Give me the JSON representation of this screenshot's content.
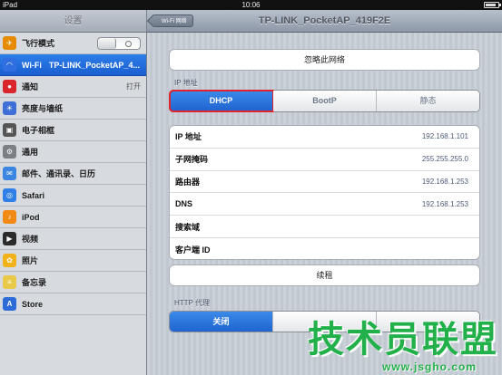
{
  "status_bar": {
    "carrier": "iPad",
    "time": "10:06",
    "battery_level": 0.85
  },
  "sidebar": {
    "title": "设置",
    "items": [
      {
        "label": "飞行模式",
        "icon": "airplane-icon",
        "color": "#e68a00",
        "toggle": true
      },
      {
        "label": "Wi-Fi",
        "network": "TP-LINK_PocketAP_4...",
        "icon": "wifi-icon",
        "color": "#2f6fe0",
        "selected": true
      },
      {
        "label": "通知",
        "value": "打开",
        "icon": "notification-icon",
        "color": "#d9262c"
      },
      {
        "label": "亮度与墙纸",
        "icon": "brightness-icon",
        "color": "#3d6fd6"
      },
      {
        "label": "电子相框",
        "icon": "picture-frame-icon",
        "color": "#555555"
      },
      {
        "label": "通用",
        "icon": "gear-icon",
        "color": "#7b7f86"
      },
      {
        "label": "邮件、通讯录、日历",
        "icon": "mail-icon",
        "color": "#3a86e0"
      },
      {
        "label": "Safari",
        "icon": "safari-icon",
        "color": "#2f7fe8"
      },
      {
        "label": "iPod",
        "icon": "ipod-icon",
        "color": "#f08a14"
      },
      {
        "label": "视频",
        "icon": "video-icon",
        "color": "#2b2b2b"
      },
      {
        "label": "照片",
        "icon": "sunflower-icon",
        "color": "#f1b21a"
      },
      {
        "label": "备忘录",
        "icon": "notes-icon",
        "color": "#e9c94a"
      },
      {
        "label": "Store",
        "icon": "store-icon",
        "color": "#2d6bd8"
      }
    ]
  },
  "nav": {
    "back_label": "Wi-Fi 网络",
    "title": "TP-LINK_PocketAP_419F2E"
  },
  "forget_button": "忽略此网络",
  "ip_section_label": "IP 地址",
  "ip_modes": [
    {
      "label": "DHCP",
      "active": true
    },
    {
      "label": "BootP",
      "active": false
    },
    {
      "label": "静态",
      "active": false
    }
  ],
  "info_rows": [
    {
      "key": "IP 地址",
      "value": "192.168.1.101"
    },
    {
      "key": "子网掩码",
      "value": "255.255.255.0"
    },
    {
      "key": "路由器",
      "value": "192.168.1.253"
    },
    {
      "key": "DNS",
      "value": "192.168.1.253"
    },
    {
      "key": "搜索域",
      "value": ""
    },
    {
      "key": "客户端 ID",
      "value": ""
    }
  ],
  "renew_button": "续租",
  "http_proxy_label": "HTTP 代理",
  "proxy_modes": [
    {
      "label": "关闭",
      "active": true
    },
    {
      "label": "",
      "active": false
    },
    {
      "label": "",
      "active": false
    }
  ],
  "watermark": {
    "text": "技术员联盟",
    "url": "www.jsgho.com"
  }
}
